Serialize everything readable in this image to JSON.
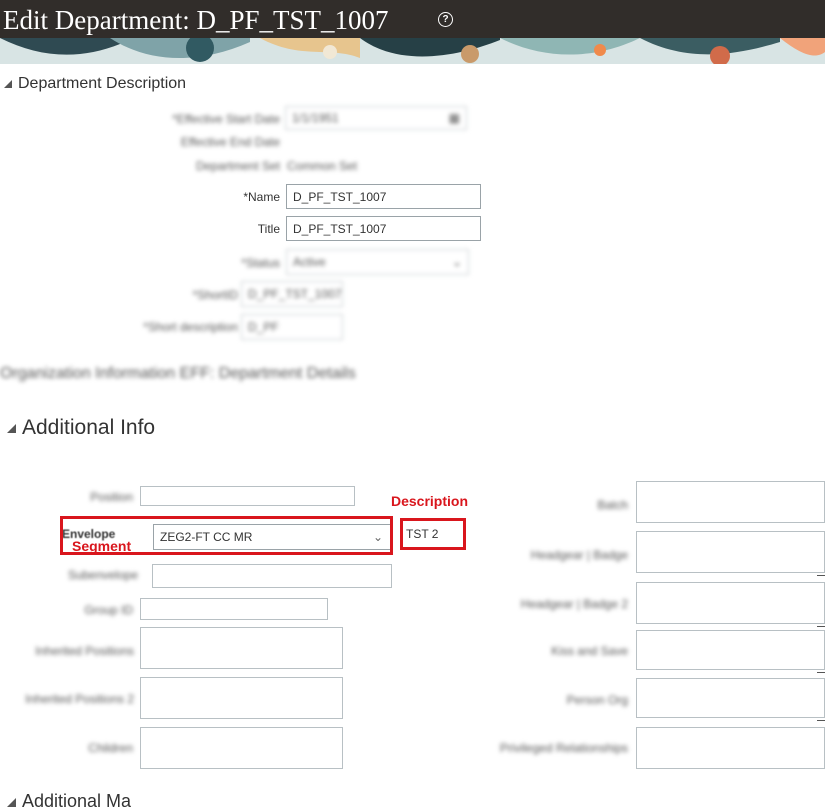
{
  "header": {
    "title": "Edit Department: D_PF_TST_1007",
    "help_icon": "help-circle-icon"
  },
  "dept_section": {
    "title": "Department Description",
    "fields": {
      "effective_start_label": "*Effective Start Date",
      "effective_start_value": "1/1/1951",
      "effective_end_label": "Effective End Date",
      "set_label": "Department Set",
      "set_value": "Common Set",
      "name_label": "Name",
      "name_required": "*",
      "name_value": "D_PF_TST_1007",
      "title_label": "Title",
      "title_value": "D_PF_TST_1007",
      "status_label": "*Status",
      "status_value": "Active",
      "shortid_label": "*ShortID",
      "shortid_value": "D_PF_TST_1007",
      "shortdesc_label": "*Short description",
      "shortdesc_value": "D_PF"
    }
  },
  "org_info_title": "Organization Information EFF: Department Details",
  "additional_info": {
    "title": "Additional Info",
    "left_labels": [
      "Position",
      "Envelope",
      "Subenvelope",
      "Group ID",
      "Inherited Positions",
      "Inherited Positions 2",
      "Children"
    ],
    "envelope_value": "ZEG2-FT CC MR",
    "description_value": "TST 2",
    "right_labels": [
      "Batch",
      "Headgear | Badge",
      "Headgear | Badge 2",
      "Kiss and Save",
      "Person Org",
      "Privileged Relationships"
    ]
  },
  "annotations": {
    "description": "Description",
    "segment": "Segment",
    "color": "#d9161d"
  },
  "partial_section": "Additional Ma"
}
